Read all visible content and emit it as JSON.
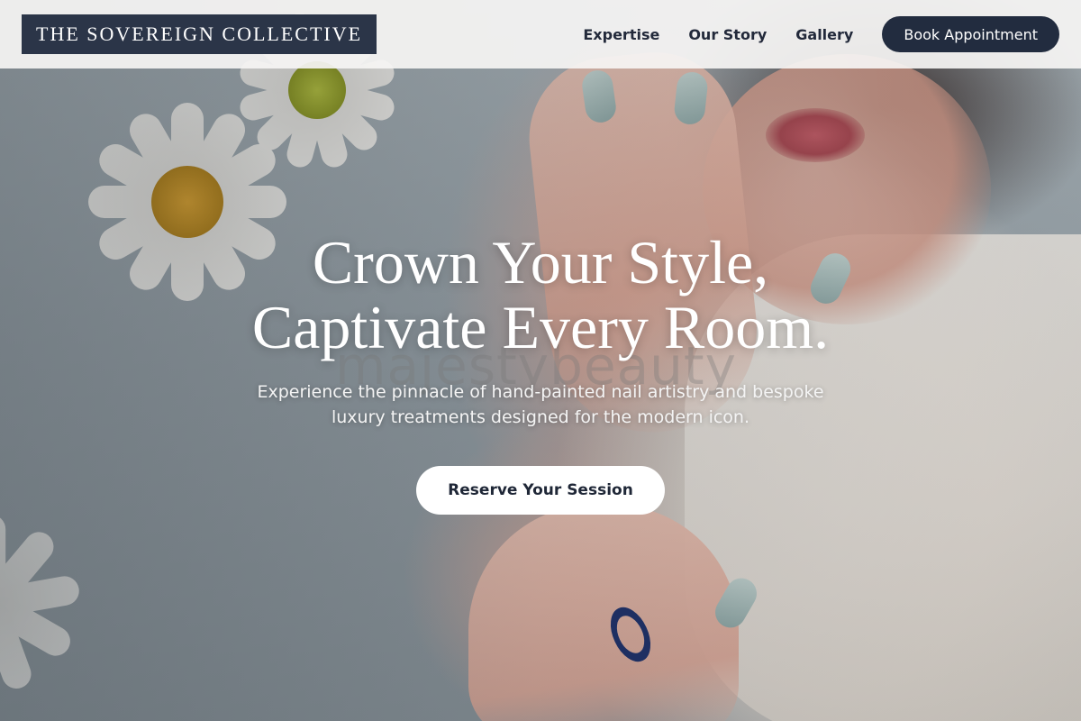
{
  "brand": {
    "name": "THE SOVEREIGN COLLECTIVE"
  },
  "nav": {
    "links": [
      {
        "label": "Expertise"
      },
      {
        "label": "Our Story"
      },
      {
        "label": "Gallery"
      }
    ],
    "cta_label": "Book Appointment"
  },
  "hero": {
    "title_line1": "Crown Your Style,",
    "title_line2": "Captivate Every Room.",
    "subtitle": "Experience the pinnacle of hand-painted nail artistry and bespoke luxury treatments designed for the modern icon.",
    "cta_label": "Reserve Your Session",
    "watermark": "majestybeauty"
  },
  "colors": {
    "brand_navy": "#2b3548",
    "button_navy": "#222c3f",
    "white": "#ffffff"
  }
}
